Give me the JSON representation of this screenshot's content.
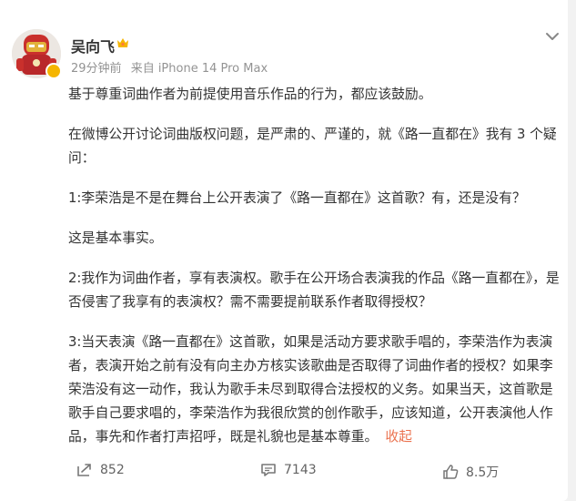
{
  "post": {
    "username": "吴向飞",
    "time": "29分钟前",
    "source": "来自 iPhone 14 Pro Max",
    "paragraphs": [
      "基于尊重词曲作者为前提使用音乐作品的行为，都应该鼓励。",
      "在微博公开讨论词曲版权问题，是严肃的、严谨的，就《路一直都在》我有 3 个疑问：",
      "1:李荣浩是不是在舞台上公开表演了《路一直都在》这首歌？有，还是没有？",
      "这是基本事实。",
      "2:我作为词曲作者，享有表演权。歌手在公开场合表演我的作品《路一直都在》，是否侵害了我享有的表演权？需不需要提前联系作者取得授权？",
      "3:当天表演《路一直都在》这首歌，如果是活动方要求歌手唱的，李荣浩作为表演者，表演开始之前有没有向主办方核实该歌曲是否取得了词曲作者的授权？如果李荣浩没有这一动作，我认为歌手未尽到取得合法授权的义务。如果当天，这首歌是歌手自己要求唱的，李荣浩作为我很欣赏的创作歌手，应该知道，公开表演他人作品，事先和作者打声招呼，既是礼貌也是基本尊重。"
    ],
    "collapse_label": "收起"
  },
  "actions": {
    "forward_count": "852",
    "comment_count": "7143",
    "like_count": "8.5万"
  },
  "icons": {
    "badge": "verified-badge-icon",
    "crown": "crown-icon",
    "menu": "chevron-down-icon",
    "forward": "forward-icon",
    "comment": "comment-icon",
    "like": "like-icon"
  },
  "colors": {
    "accent": "#eb7350",
    "meta": "#939393",
    "badge": "#f5b500"
  }
}
